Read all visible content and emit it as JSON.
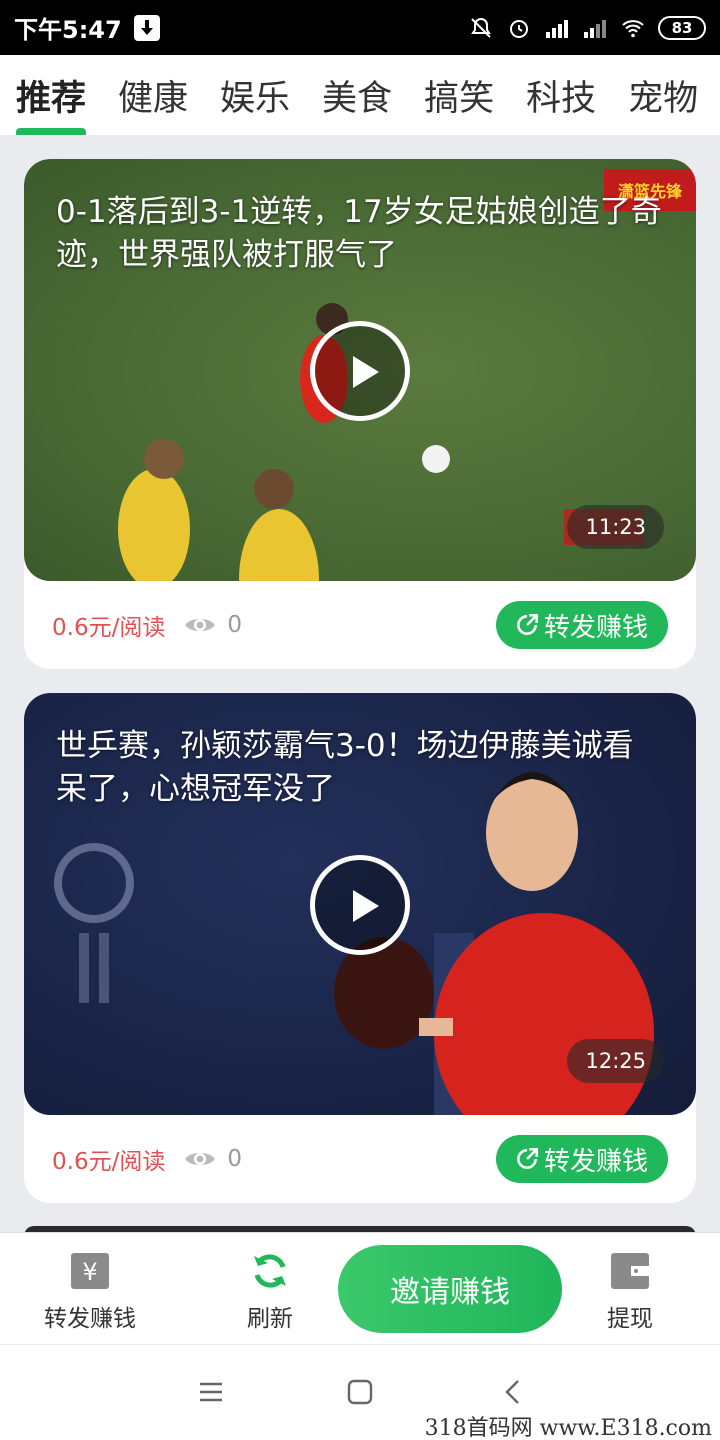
{
  "status_bar": {
    "time": "下午5:47",
    "battery": "83"
  },
  "tabs": [
    {
      "label": "推荐",
      "active": true
    },
    {
      "label": "健康"
    },
    {
      "label": "娱乐"
    },
    {
      "label": "美食"
    },
    {
      "label": "搞笑"
    },
    {
      "label": "科技"
    },
    {
      "label": "宠物"
    }
  ],
  "feed": [
    {
      "title": "0-1落后到3-1逆转，17岁女足姑娘创造了奇迹，世界强队被打服气了",
      "duration": "11:23",
      "price": "0.6元/阅读",
      "views": "0",
      "share_label": "转发赚钱",
      "watermark_text": "潇篮先锋"
    },
    {
      "title": "世乒赛，孙颖莎霸气3-0！场边伊藤美诚看呆了，心想冠军没了",
      "duration": "12:25",
      "price": "0.6元/阅读",
      "views": "0",
      "share_label": "转发赚钱"
    }
  ],
  "bottom_bar": {
    "share_earn": "转发赚钱",
    "refresh": "刷新",
    "invite": "邀请赚钱",
    "withdraw": "提现"
  },
  "colors": {
    "accent": "#21b85c",
    "price": "#e05252"
  },
  "footer_watermark": "318首码网  www.E318.com"
}
